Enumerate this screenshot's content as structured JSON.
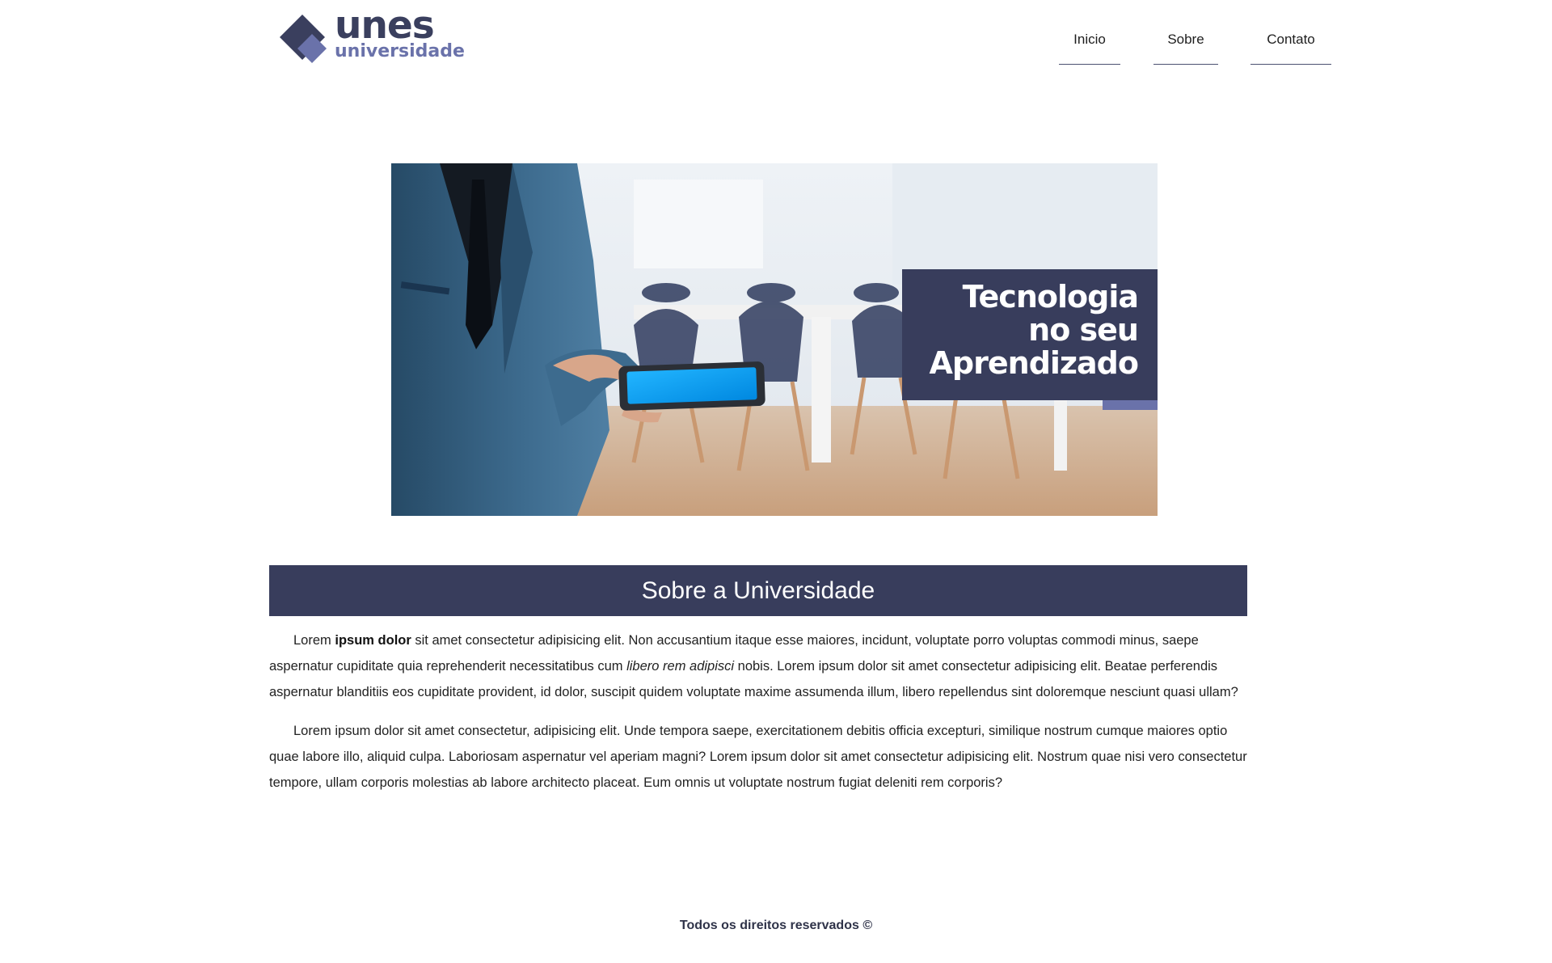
{
  "header": {
    "logo": {
      "word": "unes",
      "sub": "universidade"
    },
    "nav": [
      {
        "label": "Inicio"
      },
      {
        "label": "Sobre"
      },
      {
        "label": "Contato"
      }
    ]
  },
  "banner": {
    "caption_line1": "Tecnologia",
    "caption_line2": "no seu",
    "caption_line3": "Aprendizado"
  },
  "about": {
    "title": "Sobre a Universidade",
    "p1_a": "Lorem ",
    "p1_bold": "ipsum dolor",
    "p1_b": " sit amet consectetur adipisicing elit. Non accusantium itaque esse maiores, incidunt, voluptate porro voluptas commodi minus, saepe aspernatur cupiditate quia reprehenderit necessitatibus cum ",
    "p1_italic": "libero rem adipisci",
    "p1_c": " nobis. Lorem ipsum dolor sit amet consectetur adipisicing elit. Beatae perferendis aspernatur blanditiis eos cupiditate provident, id dolor, suscipit quidem voluptate maxime assumenda illum, libero repellendus sint doloremque nesciunt quasi ullam?",
    "p2": "Lorem ipsum dolor sit amet consectetur, adipisicing elit. Unde tempora saepe, exercitationem debitis officia excepturi, similique nostrum cumque maiores optio quae labore illo, aliquid culpa. Laboriosam aspernatur vel aperiam magni? Lorem ipsum dolor sit amet consectetur adipisicing elit. Nostrum quae nisi vero consectetur tempore, ullam corporis molestias ab labore architecto placeat. Eum omnis ut voluptate nostrum fugiat deleniti rem corporis?"
  },
  "footer": {
    "text": "Todos os direitos reservados ©"
  },
  "colors": {
    "primary": "#383d5c",
    "accent": "#6a72aa",
    "text": "#1e1e1e"
  }
}
